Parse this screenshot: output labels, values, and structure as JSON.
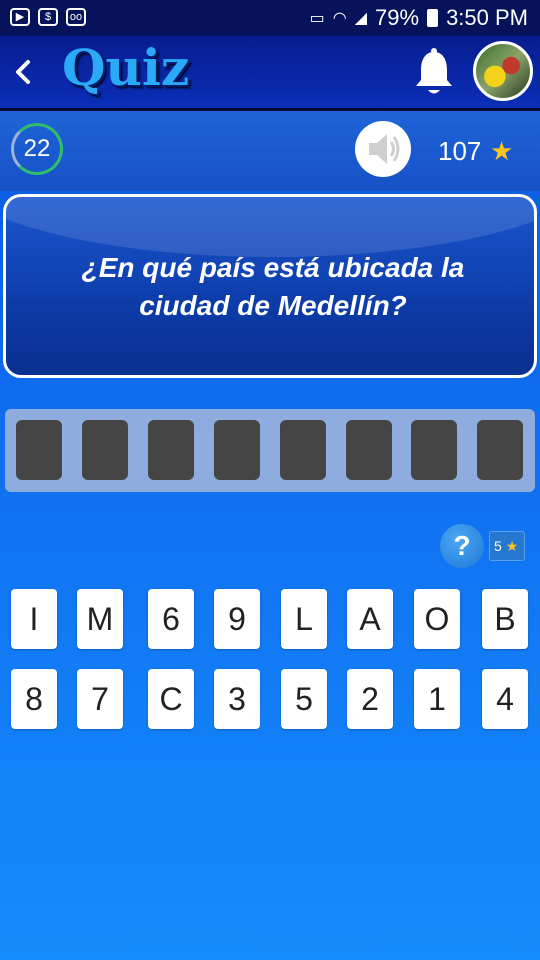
{
  "status_bar": {
    "battery": "79%",
    "time": "3:50 PM"
  },
  "app_bar": {
    "title": "Quiz"
  },
  "score_bar": {
    "timer": "22",
    "score": "107",
    "star": "★"
  },
  "question": {
    "text": "¿En qué país está ubicada la ciudad de Medellín?"
  },
  "answer_slots": 8,
  "hint": {
    "label": "?",
    "cost": "5",
    "star": "★"
  },
  "letters": [
    "I",
    "M",
    "6",
    "9",
    "L",
    "A",
    "O",
    "B",
    "8",
    "7",
    "C",
    "3",
    "5",
    "2",
    "1",
    "4"
  ],
  "colors": {
    "accent": "#2aa9f6",
    "slot": "#454545",
    "star": "#f8c51e",
    "timer_ring": "#2fbf6a"
  }
}
